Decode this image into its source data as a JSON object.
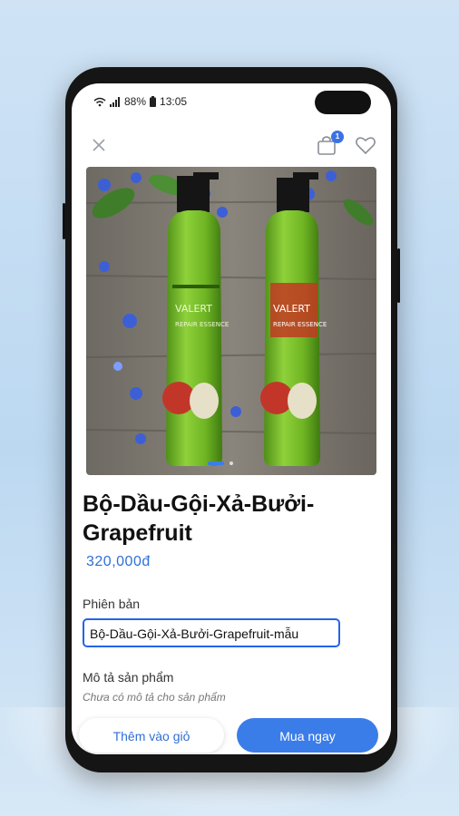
{
  "status": {
    "battery": "88%",
    "time": "13:05"
  },
  "header": {
    "cart_count": "1"
  },
  "product": {
    "title": "Bộ-Dầu-Gội-Xả-Bưởi-Grapefruit",
    "price": "320,000đ",
    "image_icon": "shampoo-bottles-photo",
    "bottle_brand": "VALERT",
    "bottle_line": "REPAIR ESSENCE"
  },
  "variant": {
    "label": "Phiên bản",
    "selected": "Bộ-Dầu-Gội-Xả-Bưởi-Grapefruit-mẫu"
  },
  "description": {
    "label": "Mô tả sản phẩm",
    "empty_text": "Chưa có mô tả cho sản phẩm"
  },
  "actions": {
    "add_to_cart": "Thêm vào giỏ",
    "buy_now": "Mua ngay"
  },
  "colors": {
    "accent": "#3b7de8",
    "price": "#2f6fd6"
  }
}
